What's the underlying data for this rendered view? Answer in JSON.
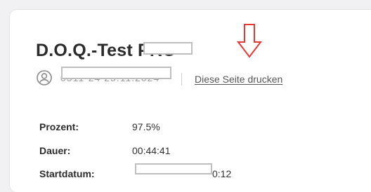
{
  "result": {
    "title": "D.O.Q.-Test PRO",
    "meta_text": "0511-24 25.11.2024",
    "print_link": "Diese Seite drucken"
  },
  "stats": [
    {
      "label": "Prozent:",
      "value": "97.5%"
    },
    {
      "label": "Dauer:",
      "value": "00:44:41"
    },
    {
      "label": "Startdatum:",
      "value": "0:12"
    }
  ],
  "annotation": {
    "arrow_color": "#e53935"
  }
}
